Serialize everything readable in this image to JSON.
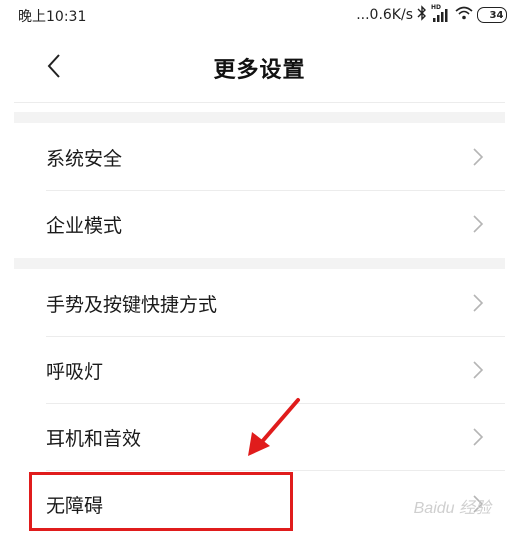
{
  "status_bar": {
    "time": "晚上10:31",
    "network_speed": "...0.6K/s",
    "signal_badge": "HD",
    "battery_level": "34"
  },
  "header": {
    "title": "更多设置"
  },
  "sections": [
    {
      "items": [
        {
          "label": "系统安全"
        },
        {
          "label": "企业模式"
        }
      ]
    },
    {
      "items": [
        {
          "label": "手势及按键快捷方式"
        },
        {
          "label": "呼吸灯"
        },
        {
          "label": "耳机和音效"
        },
        {
          "label": "无障碍"
        }
      ]
    }
  ],
  "annotation": {
    "color": "#e01c1c",
    "highlighted_item": "无障碍"
  },
  "watermark": "Baidu 经验"
}
